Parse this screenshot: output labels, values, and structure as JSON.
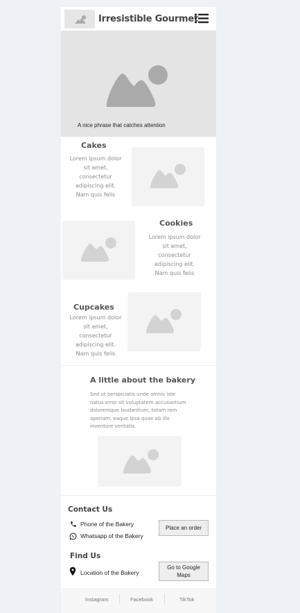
{
  "header": {
    "brand": "Irresistible Gourmet"
  },
  "hero": {
    "tagline": "A nice phrase that catches attention"
  },
  "products": [
    {
      "title": "Cakes",
      "lines": [
        "Lorem ipsum dolor",
        "sit amet,",
        "consectetur",
        "adipiscing elit.",
        "Nam quis felis"
      ]
    },
    {
      "title": "Cookies",
      "lines": [
        "Lorem ipsum dolor",
        "sit amet,",
        "consectetur",
        "adipiscing elit.",
        "Nam quis felis"
      ]
    },
    {
      "title": "Cupcakes",
      "lines": [
        "Lorem ipsum dolor",
        "sit amet,",
        "consectetur",
        "adipiscing elit.",
        "Nam quis felis"
      ]
    }
  ],
  "about": {
    "title": "A little about the bakery",
    "lines": [
      "Sed ut perspiciatis unde omnis iste",
      "natus error sit voluptatem accusantium",
      "doloremque laudantium, totam rem",
      "aperiam, eaque ipsa quae ab illo",
      "inventore veritatis."
    ]
  },
  "contact": {
    "title": "Contact Us",
    "phone": "Phone of the Bakery",
    "whatsapp": "Whatsapp of the Bakery",
    "order_button": "Place an order"
  },
  "find": {
    "title": "Find Us",
    "location": "Location of the Bakery",
    "maps_button_line1": "Go to Google",
    "maps_button_line2": "Maps"
  },
  "footer": {
    "links": [
      "Instagram",
      "Facebook",
      "TikTok"
    ]
  },
  "colors": {
    "placeholder_bg": "#e4e4e4",
    "placeholder_icon": "#aaaaaa",
    "image_box_bg": "#f4f3f3",
    "image_icon": "#d3d3d3"
  }
}
